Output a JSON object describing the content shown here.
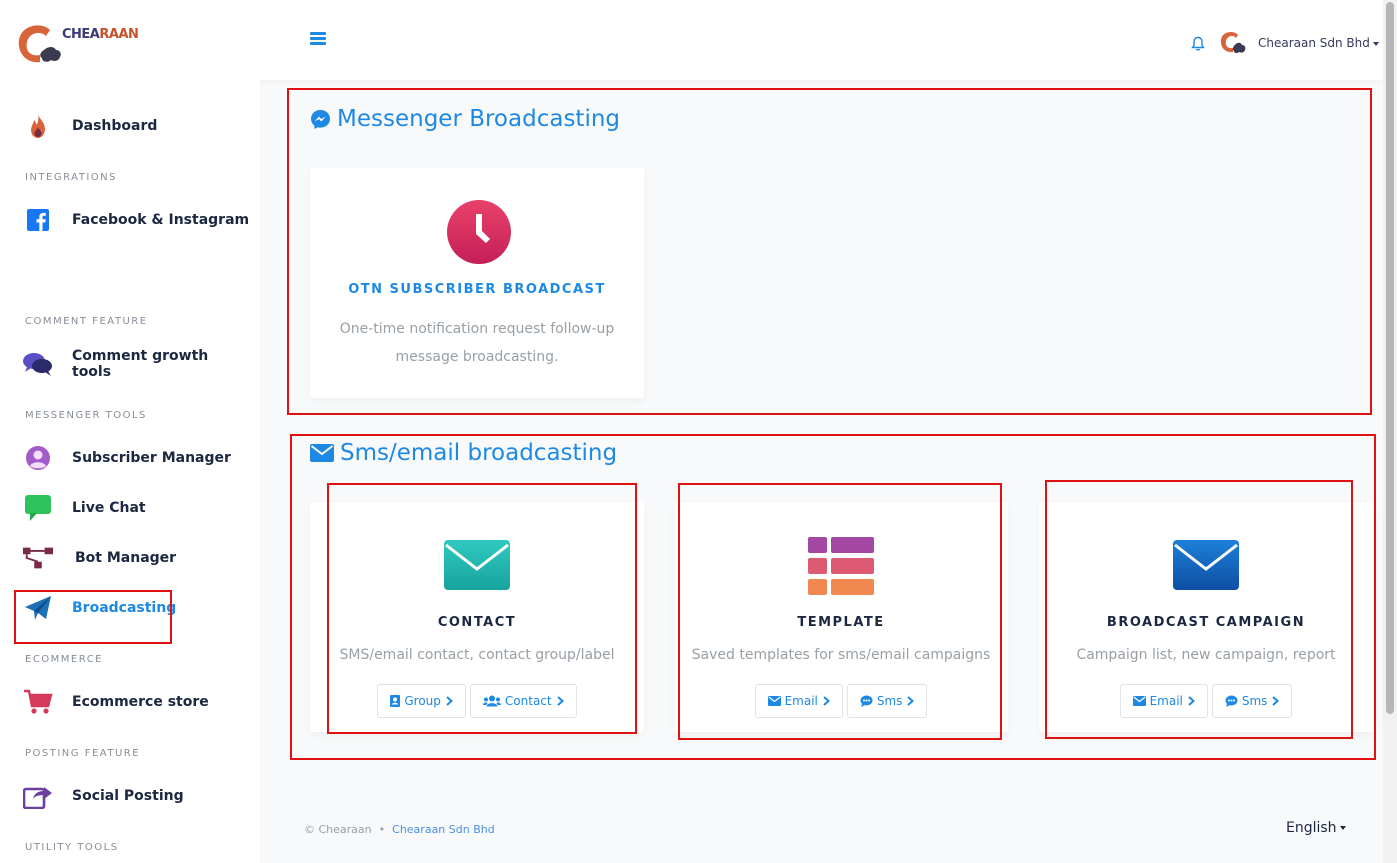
{
  "brand": {
    "logo_part1": "CHEA",
    "logo_part2": "RAAN",
    "logo_small": "CHEARAAN"
  },
  "header": {
    "user_name": "Chearaan Sdn Bhd"
  },
  "sidebar": {
    "dashboard": "Dashboard",
    "h_integrations": "INTEGRATIONS",
    "facebook": "Facebook & Instagram",
    "h_comment": "COMMENT FEATURE",
    "comment_growth": "Comment growth tools",
    "h_messenger": "MESSENGER TOOLS",
    "subscriber": "Subscriber Manager",
    "live_chat": "Live Chat",
    "bot_manager": "Bot Manager",
    "broadcasting": "Broadcasting",
    "h_ecommerce": "ECOMMERCE",
    "ecommerce": "Ecommerce store",
    "h_posting": "POSTING FEATURE",
    "social": "Social Posting",
    "h_utility": "UTILITY TOOLS"
  },
  "messenger": {
    "title": "Messenger Broadcasting",
    "otn_title": "OTN SUBSCRIBER BROADCAST",
    "otn_desc_line1": "One-time notification request follow-up",
    "otn_desc_line2": "message broadcasting."
  },
  "sms": {
    "title": "Sms/email broadcasting",
    "contact": {
      "title": "CONTACT",
      "desc": "SMS/email contact, contact group/label",
      "btn1": "Group",
      "btn2": "Contact"
    },
    "template": {
      "title": "TEMPLATE",
      "desc": "Saved templates for sms/email campaigns",
      "btn1": "Email",
      "btn2": "Sms"
    },
    "campaign": {
      "title": "BROADCAST CAMPAIGN",
      "desc": "Campaign list, new campaign, report",
      "btn1": "Email",
      "btn2": "Sms"
    }
  },
  "footer": {
    "copyright": "© Chearaan",
    "separator": "•",
    "company": "Chearaan Sdn Bhd",
    "language": "English"
  },
  "colors": {
    "accent": "#1d89e4",
    "highlight": "#e01111",
    "title_dark": "#1b2840"
  }
}
